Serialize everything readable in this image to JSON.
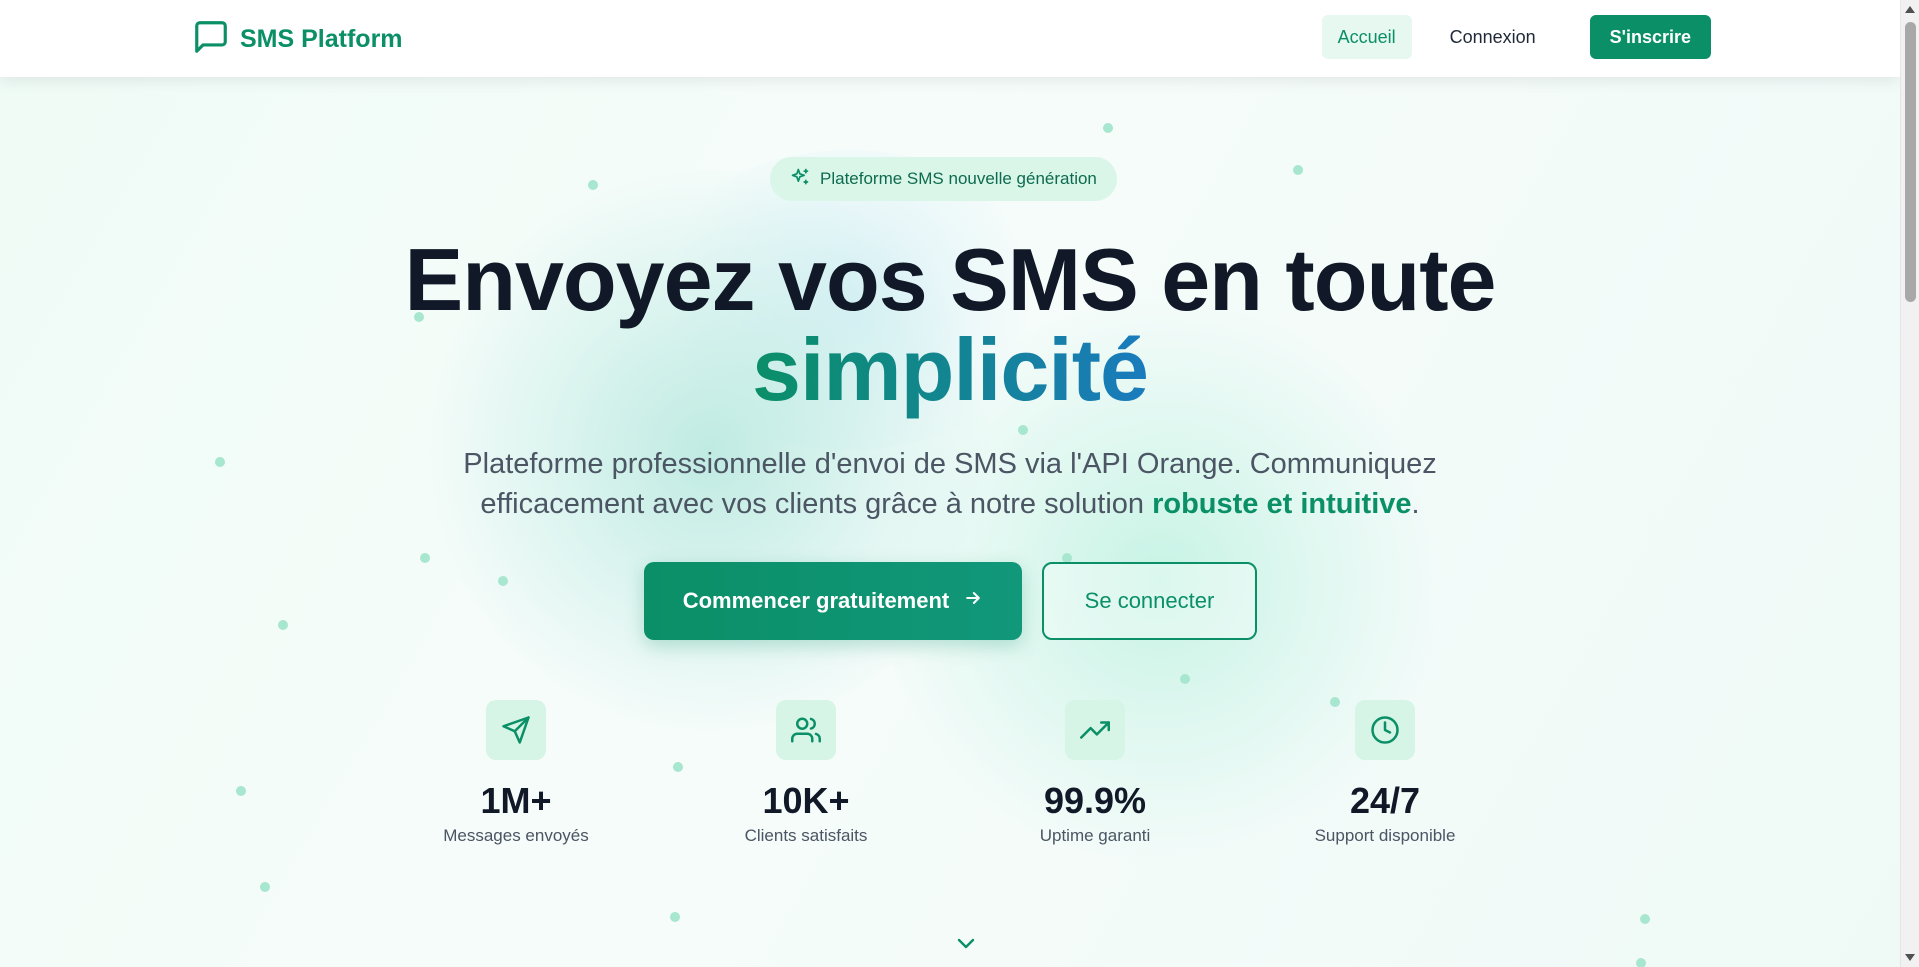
{
  "nav": {
    "brand": "SMS Platform",
    "links": [
      "Accueil",
      "Connexion"
    ],
    "signup": "S'inscrire"
  },
  "hero": {
    "badge": "Plateforme SMS nouvelle génération",
    "title_line1": "Envoyez vos SMS en toute",
    "title_accent": "simplicité",
    "subtitle_start": "Plateforme professionnelle d'envoi de SMS via l'API Orange. Communiquez efficacement avec vos clients grâce à notre solution ",
    "subtitle_strong": "robuste et intuitive",
    "subtitle_end": ".",
    "cta_primary": "Commencer gratuitement",
    "cta_secondary": "Se connecter"
  },
  "stats": [
    {
      "icon": "send-icon",
      "value": "1M+",
      "label": "Messages envoyés"
    },
    {
      "icon": "users-icon",
      "value": "10K+",
      "label": "Clients satisfaits"
    },
    {
      "icon": "trending-up-icon",
      "value": "99.9%",
      "label": "Uptime garanti"
    },
    {
      "icon": "clock-icon",
      "value": "24/7",
      "label": "Support disponible"
    }
  ],
  "colors": {
    "primary": "#0b8f67",
    "accent_blue": "#1a7bbd",
    "badge_bg": "#d9f6e9",
    "text_dark": "#111827"
  }
}
